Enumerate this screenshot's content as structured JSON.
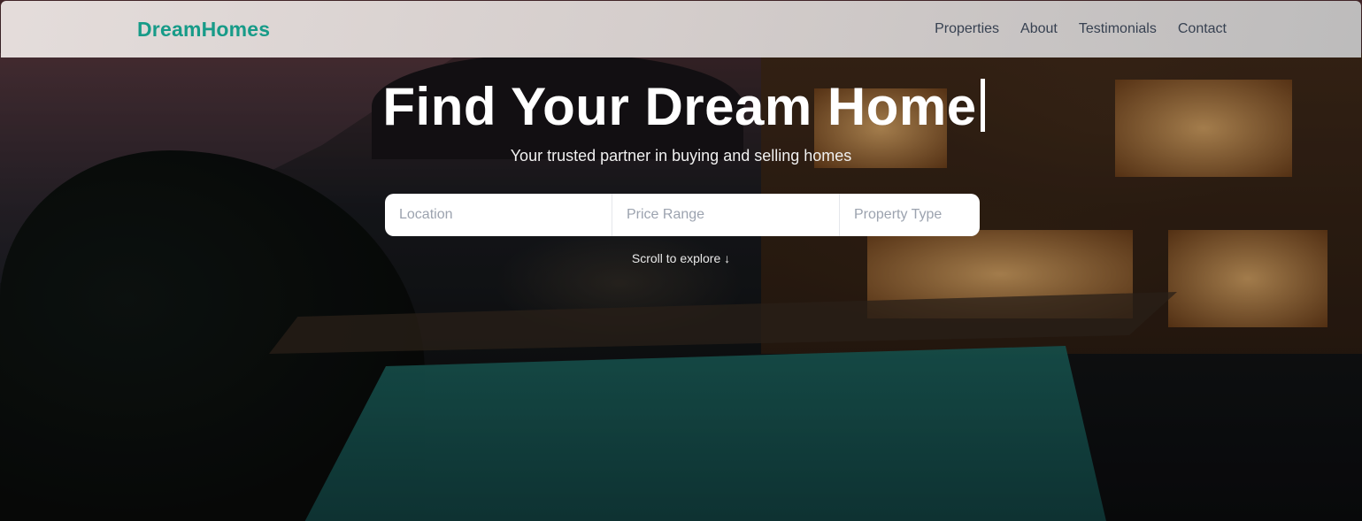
{
  "brand": {
    "logo": "DreamHomes",
    "accent_color": "#179b88"
  },
  "nav": {
    "items": [
      {
        "label": "Properties"
      },
      {
        "label": "About"
      },
      {
        "label": "Testimonials"
      },
      {
        "label": "Contact"
      }
    ]
  },
  "hero": {
    "headline": "Find Your Dream Home",
    "subtitle": "Your trusted partner in buying and selling homes",
    "background_image": "night-villa-with-pool-photo"
  },
  "search": {
    "location_placeholder": "Location",
    "price_placeholder": "Price Range",
    "type_placeholder": "Property Type"
  },
  "scroll_hint": {
    "label": "Scroll to explore ↓"
  }
}
